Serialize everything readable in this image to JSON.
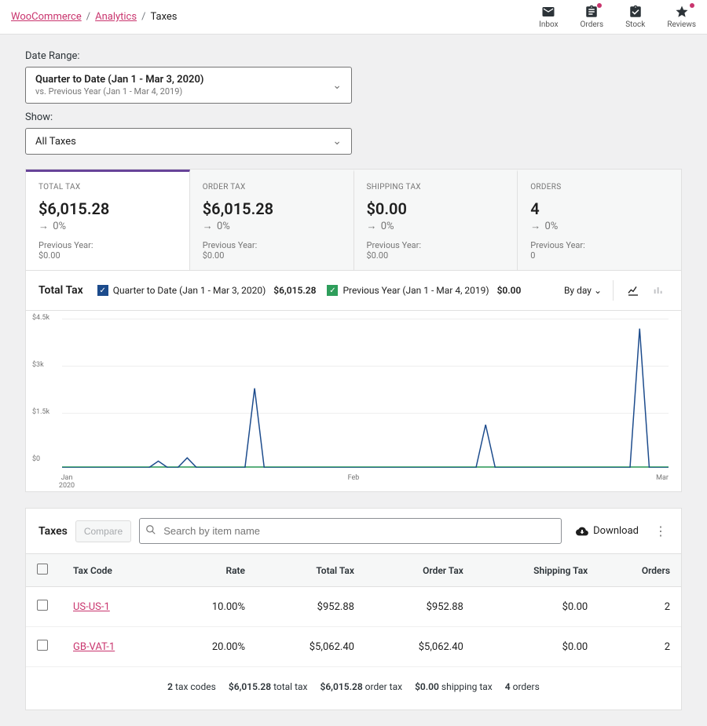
{
  "breadcrumb": {
    "l1": "WooCommerce",
    "l2": "Analytics",
    "current": "Taxes"
  },
  "topbar": {
    "inbox": "Inbox",
    "orders": "Orders",
    "stock": "Stock",
    "reviews": "Reviews"
  },
  "filters": {
    "date_label": "Date Range:",
    "date_main": "Quarter to Date (Jan 1 - Mar 3, 2020)",
    "date_sub": "vs. Previous Year (Jan 1 - Mar 4, 2019)",
    "show_label": "Show:",
    "show_value": "All Taxes"
  },
  "cards": [
    {
      "label": "TOTAL TAX",
      "value": "$6,015.28",
      "delta": "0%",
      "prev_label": "Previous Year:",
      "prev_value": "$0.00",
      "active": true
    },
    {
      "label": "ORDER TAX",
      "value": "$6,015.28",
      "delta": "0%",
      "prev_label": "Previous Year:",
      "prev_value": "$0.00",
      "active": false
    },
    {
      "label": "SHIPPING TAX",
      "value": "$0.00",
      "delta": "0%",
      "prev_label": "Previous Year:",
      "prev_value": "$0.00",
      "active": false
    },
    {
      "label": "ORDERS",
      "value": "4",
      "delta": "0%",
      "prev_label": "Previous Year:",
      "prev_value": "0",
      "active": false
    }
  ],
  "chart_header": {
    "title": "Total Tax",
    "legend1_label": "Quarter to Date (Jan 1 - Mar 3, 2020)",
    "legend1_value": "$6,015.28",
    "legend2_label": "Previous Year (Jan 1 - Mar 4, 2019)",
    "legend2_value": "$0.00",
    "interval": "By day"
  },
  "chart_data": {
    "type": "line",
    "title": "Total Tax",
    "ylabel": "",
    "xlabel": "",
    "ylim": [
      0,
      4500
    ],
    "y_ticks": [
      "$0",
      "$1.5k",
      "$3k",
      "$4.5k"
    ],
    "x_ticks": [
      "Jan",
      "Feb",
      "Mar"
    ],
    "x_subtick": "2020",
    "categories_days": 63,
    "series": [
      {
        "name": "Quarter to Date (Jan 1 - Mar 3, 2020)",
        "color": "#1c4b8c",
        "points": [
          {
            "day": 10,
            "value": 200
          },
          {
            "day": 13,
            "value": 300
          },
          {
            "day": 20,
            "value": 2400
          },
          {
            "day": 44,
            "value": 1300
          },
          {
            "day": 60,
            "value": 4200
          }
        ]
      },
      {
        "name": "Previous Year (Jan 1 - Mar 4, 2019)",
        "color": "#2e9e5b",
        "flat_value": 0
      }
    ]
  },
  "table": {
    "title": "Taxes",
    "compare": "Compare",
    "search_placeholder": "Search by item name",
    "download": "Download",
    "cols": {
      "code": "Tax Code",
      "rate": "Rate",
      "total": "Total Tax",
      "order": "Order Tax",
      "shipping": "Shipping Tax",
      "orders": "Orders"
    },
    "rows": [
      {
        "code": "US-US-1",
        "rate": "10.00%",
        "total": "$952.88",
        "order": "$952.88",
        "shipping": "$0.00",
        "orders": "2"
      },
      {
        "code": "GB-VAT-1",
        "rate": "20.00%",
        "total": "$5,062.40",
        "order": "$5,062.40",
        "shipping": "$0.00",
        "orders": "2"
      }
    ],
    "footer": {
      "codes_n": "2",
      "codes_t": "tax codes",
      "total_n": "$6,015.28",
      "total_t": "total tax",
      "order_n": "$6,015.28",
      "order_t": "order tax",
      "ship_n": "$0.00",
      "ship_t": "shipping tax",
      "orders_n": "4",
      "orders_t": "orders"
    }
  }
}
